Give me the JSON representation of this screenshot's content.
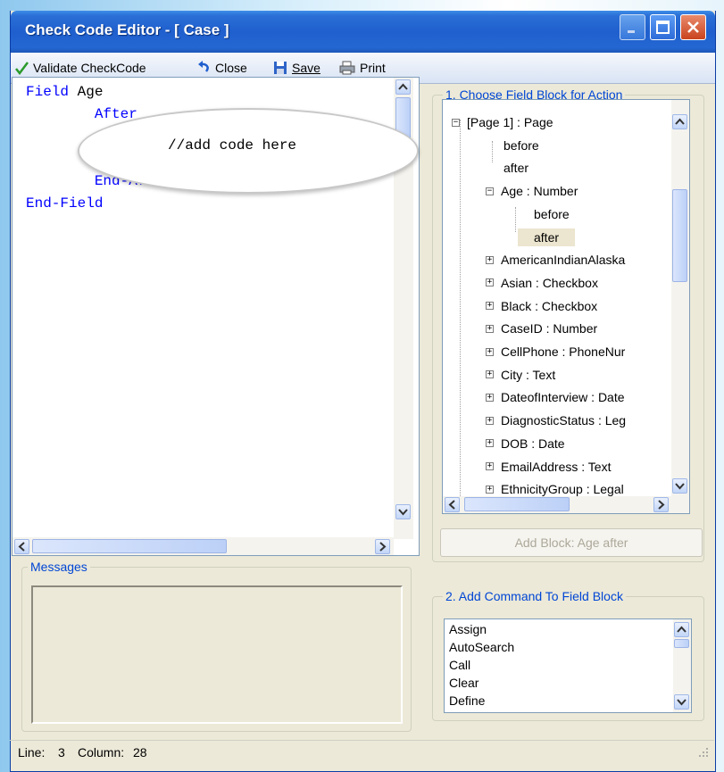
{
  "window": {
    "title": "Check Code Editor - [ Case ]"
  },
  "toolbar": {
    "validate_label": "Validate CheckCode",
    "close_label": "Close",
    "save_label": "Save",
    "print_label": "Print"
  },
  "editor": {
    "lines": [
      "Field",
      "Age",
      "After",
      "End-After",
      "End-Field"
    ],
    "hint": "//add code here"
  },
  "tree_section": {
    "legend": "1. Choose Field Block for Action",
    "nodes": [
      {
        "label": "[Page 1] : Page",
        "expander": "−"
      },
      {
        "label": "before",
        "expander": ""
      },
      {
        "label": "after",
        "expander": ""
      },
      {
        "label": "Age : Number",
        "expander": "−"
      },
      {
        "label": "before",
        "expander": ""
      },
      {
        "label": "after",
        "expander": ""
      },
      {
        "label": "AmericanIndianAlaska",
        "expander": "+"
      },
      {
        "label": "Asian : Checkbox",
        "expander": "+"
      },
      {
        "label": "Black : Checkbox",
        "expander": "+"
      },
      {
        "label": "CaseID : Number",
        "expander": "+"
      },
      {
        "label": "CellPhone : PhoneNur",
        "expander": "+"
      },
      {
        "label": "City : Text",
        "expander": "+"
      },
      {
        "label": "DateofInterview : Date",
        "expander": "+"
      },
      {
        "label": "DiagnosticStatus : Leg",
        "expander": "+"
      },
      {
        "label": "DOB : Date",
        "expander": "+"
      },
      {
        "label": "EmailAddress : Text",
        "expander": "+"
      },
      {
        "label": "EthnicityGroup : Legal",
        "expander": "+"
      }
    ],
    "add_block_label": "Add Block: Age after"
  },
  "command_section": {
    "legend": "2. Add Command To Field Block",
    "commands": [
      "Assign",
      "AutoSearch",
      "Call",
      "Clear",
      "Define"
    ]
  },
  "messages": {
    "legend": "Messages"
  },
  "status": {
    "line_label": "Line:",
    "line": "3",
    "column_label": "Column:",
    "column": "28"
  },
  "colors": {
    "keyword": "#0000ff",
    "title_bar": "#1f5fce",
    "legend": "#0046d5"
  }
}
